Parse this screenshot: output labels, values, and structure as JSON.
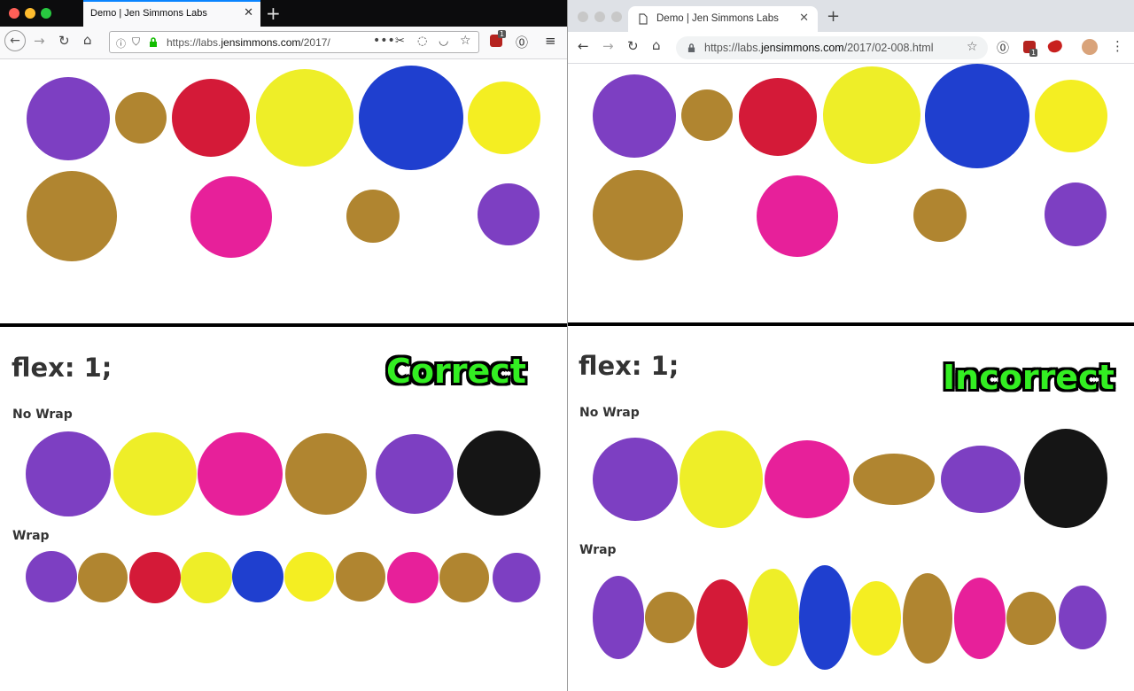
{
  "colors": {
    "purple": "#7d3fc2",
    "gold": "#b08530",
    "red": "#d41a38",
    "yellow": "#eeee28",
    "blue": "#1f3fcf",
    "pink": "#e7209a",
    "black": "#151515",
    "green_badge": "#33ee22"
  },
  "left_browser": {
    "app": "Firefox",
    "tab_title": "Demo | Jen Simmons Labs",
    "url_prefix": "https://labs.",
    "url_domain": "jensimmons.com",
    "url_path": "/2017/",
    "badge_count": "1"
  },
  "right_browser": {
    "app": "Chrome",
    "tab_title": "Demo | Jen Simmons Labs",
    "url_prefix": "https://labs.",
    "url_domain": "jensimmons.com",
    "url_path": "/2017/02-008.html",
    "badge_count": "1"
  },
  "left_demo": {
    "heading": "flex: 1;",
    "verdict": "Correct",
    "label_nowrap": "No Wrap",
    "label_wrap": "Wrap"
  },
  "right_demo": {
    "heading": "flex: 1;",
    "verdict": "Incorrect",
    "label_nowrap": "No Wrap",
    "label_wrap": "Wrap"
  }
}
